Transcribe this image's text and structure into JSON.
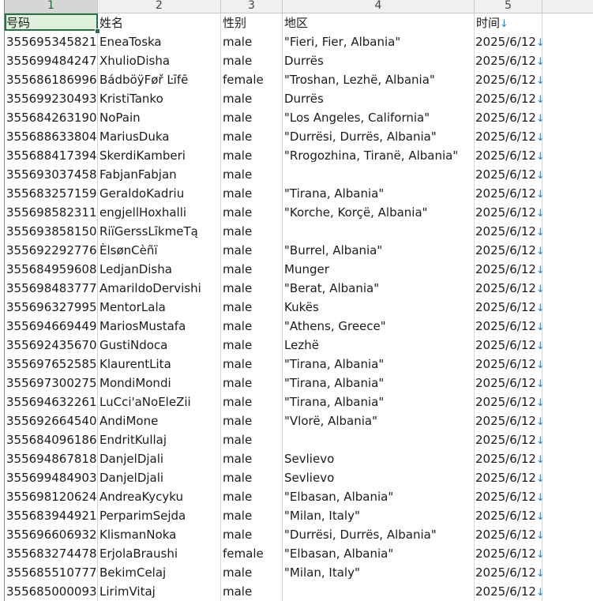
{
  "columns": [
    "1",
    "2",
    "3",
    "4",
    "5"
  ],
  "header": {
    "phone": "号码",
    "name": "姓名",
    "gender": "性别",
    "region": "地区",
    "time": "时间"
  },
  "filter_arrow": "↓",
  "rows": [
    {
      "phone": "355695345821",
      "name": "EneaToska",
      "gender": "male",
      "region": "\"Fieri, Fier, Albania\"",
      "time": "2025/6/12"
    },
    {
      "phone": "355699484247",
      "name": "XhulioDisha",
      "gender": "male",
      "region": "Durrës",
      "time": "2025/6/12"
    },
    {
      "phone": "355686186996",
      "name": "BádböÿFøř Ŀīfē",
      "gender": "female",
      "region": "\"Troshan, Lezhë, Albania\"",
      "time": "2025/6/12"
    },
    {
      "phone": "355699230493",
      "name": "KristiTanko",
      "gender": "male",
      "region": "Durrës",
      "time": "2025/6/12"
    },
    {
      "phone": "355684263190",
      "name": "NoPain",
      "gender": "male",
      "region": "\"Los Angeles, California\"",
      "time": "2025/6/12"
    },
    {
      "phone": "355688633804",
      "name": "MariusDuka",
      "gender": "male",
      "region": "\"Durrësi, Durrës, Albania\"",
      "time": "2025/6/12"
    },
    {
      "phone": "355688417394",
      "name": "SkerdiKamberi",
      "gender": "male",
      "region": "\"Rrogozhina, Tiranë, Albania\"",
      "time": "2025/6/12"
    },
    {
      "phone": "355693037458",
      "name": "FabjanFabjan",
      "gender": "male",
      "region": "",
      "time": "2025/6/12"
    },
    {
      "phone": "355683257159",
      "name": "GeraldoKadriu",
      "gender": "male",
      "region": "\"Tirana, Albania\"",
      "time": "2025/6/12"
    },
    {
      "phone": "355698582311",
      "name": "engjellHoxhalli",
      "gender": "male",
      "region": "\"Korche, Korçë, Albania\"",
      "time": "2025/6/12"
    },
    {
      "phone": "355693858150",
      "name": "RiïGerssLīkmeTą",
      "gender": "male",
      "region": "",
      "time": "2025/6/12"
    },
    {
      "phone": "355692292776",
      "name": "ÈlsønCèñï",
      "gender": "male",
      "region": "\"Burrel, Albania\"",
      "time": "2025/6/12"
    },
    {
      "phone": "355684959608",
      "name": "LedjanDisha",
      "gender": "male",
      "region": "Munger",
      "time": "2025/6/12"
    },
    {
      "phone": "355698483777",
      "name": "AmarildoDervishi",
      "gender": "male",
      "region": "\"Berat, Albania\"",
      "time": "2025/6/12"
    },
    {
      "phone": "355696327995",
      "name": "MentorLala",
      "gender": "male",
      "region": "Kukës",
      "time": "2025/6/12"
    },
    {
      "phone": "355694669449",
      "name": "MariosMustafa",
      "gender": "male",
      "region": "\"Athens, Greece\"",
      "time": "2025/6/12"
    },
    {
      "phone": "355692435670",
      "name": "GustiNdoca",
      "gender": "male",
      "region": "Lezhë",
      "time": "2025/6/12"
    },
    {
      "phone": "355697652585",
      "name": "KlaurentLita",
      "gender": "male",
      "region": "\"Tirana, Albania\"",
      "time": "2025/6/12"
    },
    {
      "phone": "355697300275",
      "name": "MondiMondi",
      "gender": "male",
      "region": "\"Tirana, Albania\"",
      "time": "2025/6/12"
    },
    {
      "phone": "355694632261",
      "name": "LuCci'aNoEleZii",
      "gender": "male",
      "region": "\"Tirana, Albania\"",
      "time": "2025/6/12"
    },
    {
      "phone": "355692664540",
      "name": "AndiMone",
      "gender": "male",
      "region": "\"Vlorë, Albania\"",
      "time": "2025/6/12"
    },
    {
      "phone": "355684096186",
      "name": "EndritKullaj",
      "gender": "male",
      "region": "",
      "time": "2025/6/12"
    },
    {
      "phone": "355694867818",
      "name": "DanjelDjali",
      "gender": "male",
      "region": "Sevlievo",
      "time": "2025/6/12"
    },
    {
      "phone": "355699484903",
      "name": "DanjelDjali",
      "gender": "male",
      "region": "Sevlievo",
      "time": "2025/6/12"
    },
    {
      "phone": "355698120624",
      "name": "AndreaKycyku",
      "gender": "male",
      "region": "\"Elbasan, Albania\"",
      "time": "2025/6/12"
    },
    {
      "phone": "355683944921",
      "name": "PerparimSejda",
      "gender": "male",
      "region": "\"Milan, Italy\"",
      "time": "2025/6/12"
    },
    {
      "phone": "355696606932",
      "name": "KlismanNoka",
      "gender": "male",
      "region": "\"Durrësi, Durrës, Albania\"",
      "time": "2025/6/12"
    },
    {
      "phone": "355683274478",
      "name": "ErjolaBraushi",
      "gender": "female",
      "region": "\"Elbasan, Albania\"",
      "time": "2025/6/12"
    },
    {
      "phone": "355685510777",
      "name": "BekimCelaj",
      "gender": "male",
      "region": "\"Milan, Italy\"",
      "time": "2025/6/12"
    },
    {
      "phone": "355685000093",
      "name": "LirimVitaj",
      "gender": "male",
      "region": "",
      "time": "2025/6/12"
    }
  ]
}
